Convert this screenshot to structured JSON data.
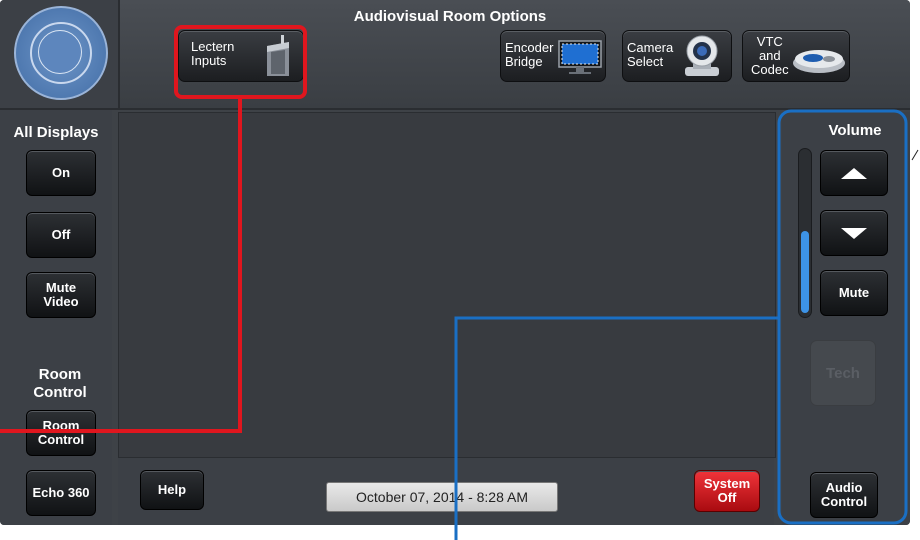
{
  "header": {
    "title": "Audiovisual Room Options",
    "buttons": [
      {
        "label_line1": "Lectern",
        "label_line2": "Inputs",
        "icon": "podium-icon"
      },
      {
        "label_line1": "Encoder",
        "label_line2": "Bridge",
        "icon": "monitor-icon"
      },
      {
        "label_line1": "Camera",
        "label_line2": "Select",
        "icon": "camera-icon"
      },
      {
        "label_line1": "VTC",
        "label_line2": "and",
        "label_line3": "Codec",
        "icon": "speakerphone-icon"
      }
    ]
  },
  "left": {
    "all_displays_label": "All Displays",
    "on_label": "On",
    "off_label": "Off",
    "mute_video_line1": "Mute",
    "mute_video_line2": "Video",
    "room_control_heading_line1": "Room",
    "room_control_heading_line2": "Control",
    "room_control_btn_line1": "Room",
    "room_control_btn_line2": "Control",
    "echo_label": "Echo 360"
  },
  "bottom": {
    "help_label": "Help",
    "datetime": "October 07, 2014  -  8:28 AM",
    "system_off_line1": "System",
    "system_off_line2": "Off"
  },
  "right": {
    "volume_label": "Volume",
    "mute_label": "Mute",
    "tech_label": "Tech",
    "audio_control_line1": "Audio",
    "audio_control_line2": "Control",
    "volume_level_fraction": 0.5
  },
  "colors": {
    "callout_red": "#e0161e",
    "callout_blue": "#1a6fc4",
    "system_off_red": "#d3141a",
    "slider_fill": "#3d93e6"
  }
}
